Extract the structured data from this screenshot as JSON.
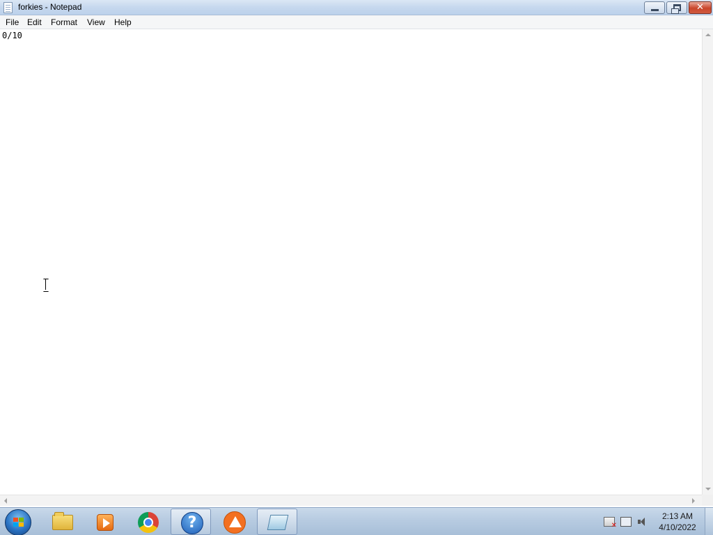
{
  "window": {
    "title": "forkies - Notepad",
    "close_glyph": "✕"
  },
  "menu": {
    "items": [
      "File",
      "Edit",
      "Format",
      "View",
      "Help"
    ]
  },
  "editor": {
    "content": "0/10"
  },
  "taskbar": {
    "pinned": [
      {
        "icon": "windows-explorer-icon"
      },
      {
        "icon": "media-player-icon"
      },
      {
        "icon": "chrome-icon"
      },
      {
        "icon": "help-icon",
        "glyph": "?"
      },
      {
        "icon": "orange-app-icon"
      },
      {
        "icon": "notepad-icon",
        "active": true
      }
    ],
    "clock": {
      "time": "2:13 AM",
      "date": "4/10/2022"
    }
  },
  "colors": {
    "titlebar": "#c6d8ee",
    "close_button": "#c9462c",
    "taskbar": "#b7cbe1"
  }
}
